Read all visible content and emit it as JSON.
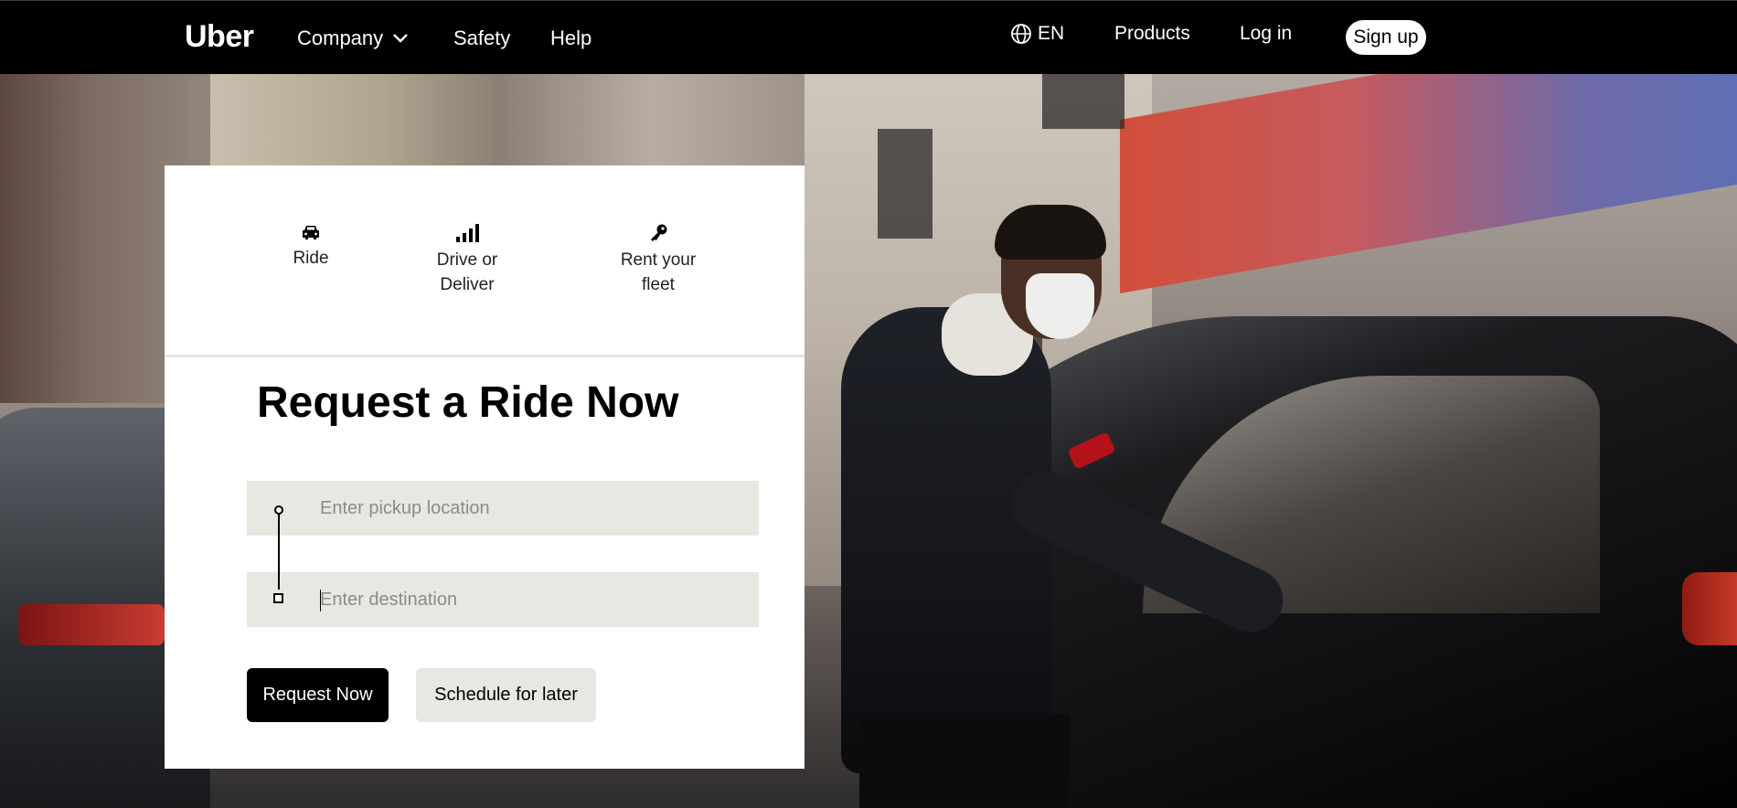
{
  "nav": {
    "logo": "Uber",
    "left_items": [
      "Company",
      "Safety",
      "Help"
    ],
    "language": "EN",
    "products": "Products",
    "login": "Log in",
    "signup": "Sign up"
  },
  "card": {
    "tabs": [
      {
        "label": "Ride",
        "icon": "car-icon"
      },
      {
        "label": "Drive or\nDeliver",
        "icon": "signal-bars-icon"
      },
      {
        "label": "Rent your\nfleet",
        "icon": "key-icon"
      }
    ],
    "title": "Request a Ride Now",
    "pickup_placeholder": "Enter pickup location",
    "pickup_value": "",
    "destination_placeholder": "Enter destination",
    "destination_value": "",
    "request_button": "Request Now",
    "schedule_button": "Schedule for later"
  },
  "colors": {
    "nav_bg": "#000000",
    "input_bg": "#e8e8e3",
    "primary_button": "#000000",
    "secondary_button": "#e8e8e3"
  }
}
